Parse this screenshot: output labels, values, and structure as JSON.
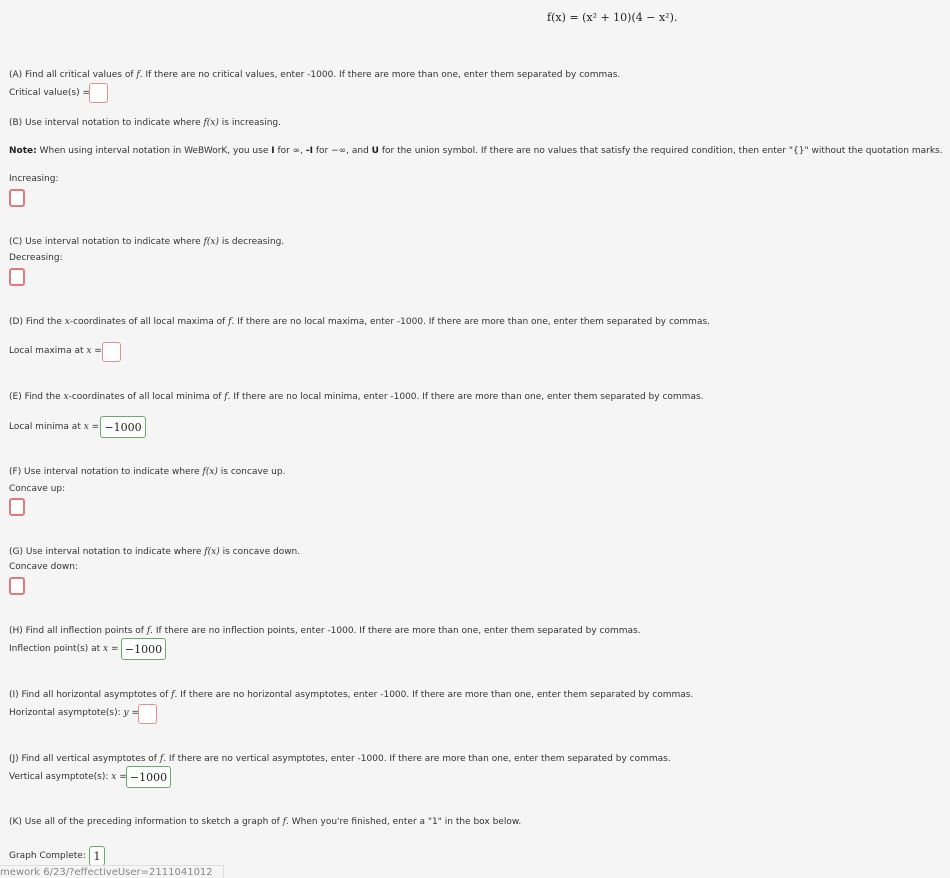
{
  "formula": "f(x) = (x² + 10)(4 − x²).",
  "partA": {
    "prompt_pre": "(A) Find all critical values of ",
    "f": "f",
    "prompt_post": ". If there are no critical values, enter -1000. If there are more than one, enter them separated by commas.",
    "label": "Critical value(s) =",
    "value": ""
  },
  "partB": {
    "prompt_pre": "(B) Use interval notation to indicate where ",
    "fx": "f(x)",
    "prompt_post": " is increasing.",
    "label": "Increasing:",
    "value": ""
  },
  "note": {
    "bold": "Note:",
    "t1": " When using interval notation in WeBWorK, you use ",
    "I": "I",
    "t2": " for ∞, ",
    "mI": "-I",
    "t3": " for −∞, and ",
    "U": "U",
    "t4": " for the union symbol. If there are no values that satisfy the required condition, then enter \"{}\" without the quotation marks."
  },
  "partC": {
    "prompt_pre": "(C) Use interval notation to indicate where ",
    "fx": "f(x)",
    "prompt_post": " is decreasing.",
    "label": "Decreasing:",
    "value": ""
  },
  "partD": {
    "prompt_pre": "(D) Find the ",
    "x": "x",
    "prompt_mid": "-coordinates of all local maxima of ",
    "f": "f",
    "prompt_post": ". If there are no local maxima, enter -1000. If there are more than one, enter them separated by commas.",
    "label_pre": "Local maxima at ",
    "label_x": "x",
    "label_post": " =",
    "value": ""
  },
  "partE": {
    "prompt_pre": "(E) Find the ",
    "x": "x",
    "prompt_mid": "-coordinates of all local minima of ",
    "f": "f",
    "prompt_post": ". If there are no local minima, enter -1000. If there are more than one, enter them separated by commas.",
    "label_pre": "Local minima at ",
    "label_x": "x",
    "label_post": " =",
    "value": "−1000"
  },
  "partF": {
    "prompt_pre": "(F) Use interval notation to indicate where ",
    "fx": "f(x)",
    "prompt_post": " is concave up.",
    "label": "Concave up:",
    "value": ""
  },
  "partG": {
    "prompt_pre": "(G) Use interval notation to indicate where ",
    "fx": "f(x)",
    "prompt_post": " is concave down.",
    "label": "Concave down:",
    "value": ""
  },
  "partH": {
    "prompt_pre": "(H) Find all inflection points of ",
    "f": "f",
    "prompt_post": ". If there are no inflection points, enter -1000. If there are more than one, enter them separated by commas.",
    "label_pre": "Inflection point(s) at ",
    "label_x": "x",
    "label_post": " =",
    "value": "−1000"
  },
  "partI": {
    "prompt_pre": "(I) Find all horizontal asymptotes of ",
    "f": "f",
    "prompt_post": ". If there are no horizontal asymptotes, enter -1000. If there are more than one, enter them separated by commas.",
    "label_pre": "Horizontal asymptote(s): ",
    "label_y": "y",
    "label_post": " =",
    "value": ""
  },
  "partJ": {
    "prompt_pre": "(J) Find all vertical asymptotes of ",
    "f": "f",
    "prompt_post": ". If there are no vertical asymptotes, enter -1000. If there are more than one, enter them separated by commas.",
    "label_pre": "Vertical asymptote(s): ",
    "label_x": "x",
    "label_post": " =",
    "value": "−1000"
  },
  "partK": {
    "prompt_pre": "(K) Use all of the preceding information to sketch a graph of ",
    "f": "f",
    "prompt_post": ". When you're finished, enter a \"1\" in the box below.",
    "label": "Graph Complete:",
    "value": "1"
  },
  "footer": "mework 6/23/?effectiveUser=2111041012"
}
